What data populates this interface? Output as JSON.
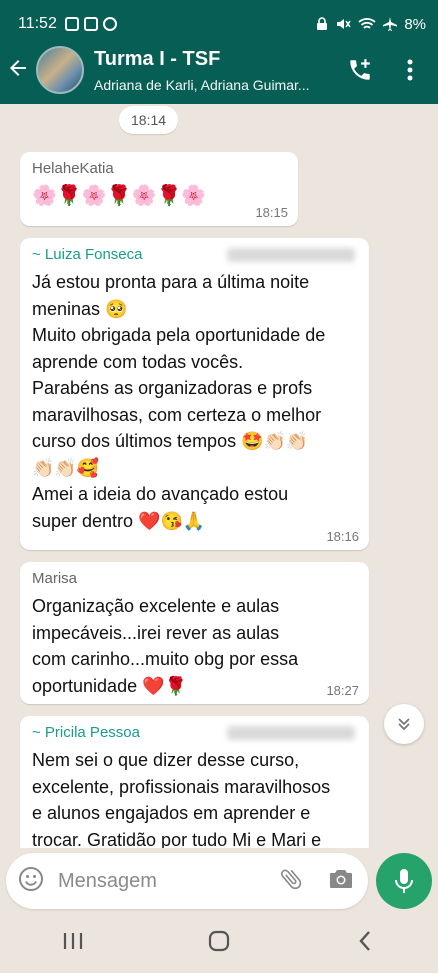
{
  "status": {
    "time": "11:52",
    "battery": "8%"
  },
  "header": {
    "title": "Turma I - TSF",
    "subtitle": "Adriana de Karli, Adriana Guimar..."
  },
  "chat": {
    "date_pill": "18:14",
    "messages": [
      {
        "sender": "HelaheKatia",
        "text": "🌸🌹🌸🌹🌸🌹🌸",
        "time": "18:15"
      },
      {
        "sender": "~ Luiza Fonseca",
        "text": "Já estou pronta para a última noite\nmeninas 🥺\nMuito obrigada pela oportunidade de\naprende com todas vocês.\nParabéns as organizadoras e profs\nmaravilhosas, com certeza o melhor\ncurso dos últimos tempos 🤩👏🏻👏🏻\n👏🏻👏🏻🥰\nAmei a ideia do avançado estou\nsuper dentro ❤️😘🙏",
        "time": "18:16"
      },
      {
        "sender": "Marisa",
        "text": "Organização excelente e aulas\nimpecáveis...irei rever as aulas\ncom carinho...muito obg por essa\noportunidade ❤️🌹",
        "time": "18:27"
      },
      {
        "sender": "~ Pricila Pessoa",
        "text": "Nem sei o que dizer desse curso,\nexcelente, profissionais maravilhosos\ne alunos engajados em aprender e\ntrocar. Gratidão por tudo Mi e  Mari e",
        "time": ""
      }
    ]
  },
  "input": {
    "placeholder": "Mensagem"
  },
  "icons": {
    "back": "arrow-left-icon",
    "call": "add-call-icon",
    "menu": "more-vert-icon",
    "emoji": "emoji-icon",
    "attach": "attach-icon",
    "camera": "camera-icon",
    "mic": "mic-icon"
  }
}
